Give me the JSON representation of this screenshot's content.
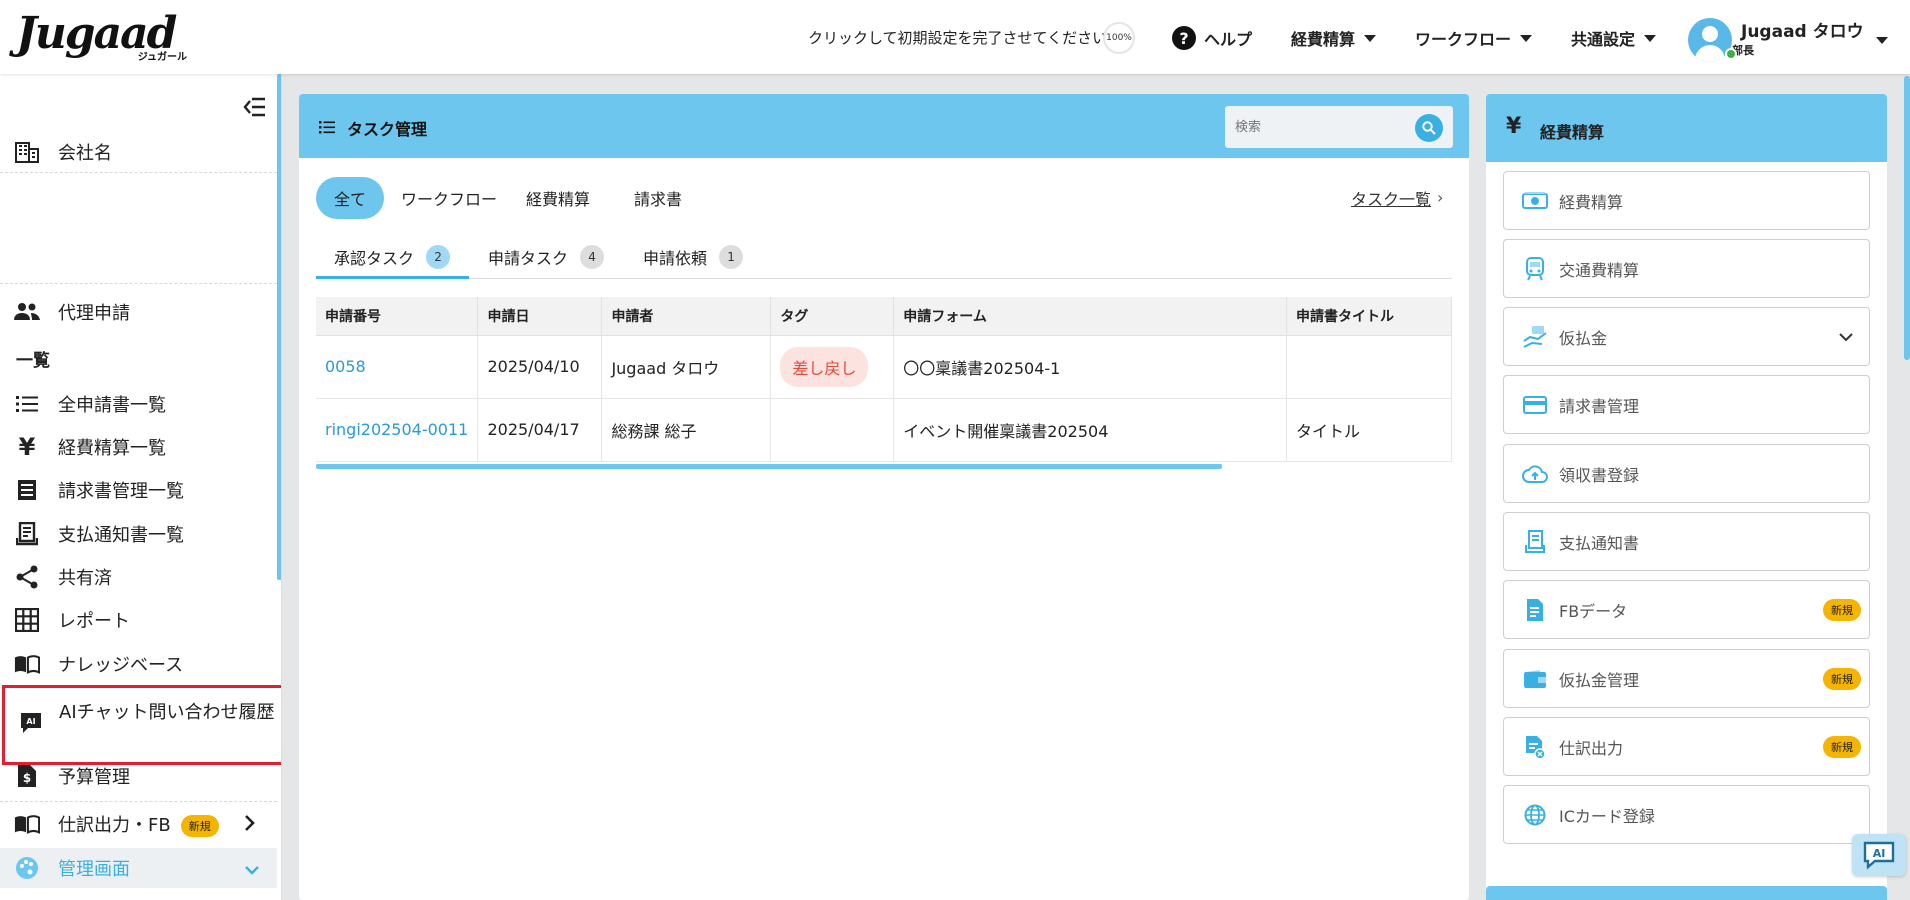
{
  "header": {
    "logo_text": "Jugaad",
    "logo_sub": "ジュガール",
    "setup_message": "クリックして初期設定を完了させてください →",
    "setup_progress": "100%",
    "help": "ヘルプ",
    "nav_expense": "経費精算",
    "nav_workflow": "ワークフロー",
    "nav_common": "共通設定",
    "user_name": "Jugaad タロウ",
    "user_role": "部長"
  },
  "sidebar": {
    "company": "会社名",
    "proxy": "代理申請",
    "list_heading": "一覧",
    "items": [
      {
        "label": "全申請書一覧",
        "icon": "list-icon"
      },
      {
        "label": "経費精算一覧",
        "icon": "yen-icon"
      },
      {
        "label": "請求書管理一覧",
        "icon": "invoice-icon"
      },
      {
        "label": "支払通知書一覧",
        "icon": "receipt-icon"
      },
      {
        "label": "共有済",
        "icon": "share-icon"
      },
      {
        "label": "レポート",
        "icon": "grid-icon"
      },
      {
        "label": "ナレッジベース",
        "icon": "book-icon"
      }
    ],
    "ai_chat": "AIチャット問い合わせ履歴",
    "budget": "予算管理",
    "journal": "仕訳出力・FB",
    "journal_badge": "新規",
    "admin": "管理画面"
  },
  "main": {
    "title": "タスク管理",
    "search_placeholder": "検索",
    "filter_tabs": [
      "全て",
      "ワークフロー",
      "経費精算",
      "請求書"
    ],
    "task_list_link": "タスク一覧",
    "sub_tabs": [
      {
        "label": "承認タスク",
        "count": "2"
      },
      {
        "label": "申請タスク",
        "count": "4"
      },
      {
        "label": "申請依頼",
        "count": "1"
      }
    ],
    "table": {
      "headers": [
        "申請番号",
        "申請日",
        "申請者",
        "タグ",
        "申請フォーム",
        "申請書タイトル"
      ],
      "rows": [
        {
          "id": "0058",
          "date": "2025/04/10",
          "applicant": "Jugaad タロウ",
          "tag": "差し戻し",
          "form": "〇〇稟議書202504-1",
          "title": ""
        },
        {
          "id": "ringi202504-0011",
          "date": "2025/04/17",
          "applicant": "総務課 総子",
          "tag": "",
          "form": "イベント開催稟議書202504",
          "title": "タイトル"
        }
      ]
    }
  },
  "right_panel": {
    "title": "経費精算",
    "new_badge": "新規",
    "buttons": [
      {
        "label": "経費精算",
        "icon": "money-icon"
      },
      {
        "label": "交通費精算",
        "icon": "train-icon"
      },
      {
        "label": "仮払金",
        "icon": "hand-money-icon"
      },
      {
        "label": "請求書管理",
        "icon": "card-icon"
      },
      {
        "label": "領収書登録",
        "icon": "cloud-upload-icon"
      },
      {
        "label": "支払通知書",
        "icon": "receipt-icon"
      },
      {
        "label": "FBデータ",
        "icon": "document-icon"
      },
      {
        "label": "仮払金管理",
        "icon": "wallet-icon"
      },
      {
        "label": "仕訳出力",
        "icon": "journal-icon"
      },
      {
        "label": "ICカード登録",
        "icon": "globe-icon"
      }
    ]
  },
  "colors": {
    "accent": "#6cc6ee",
    "accent_dark": "#3ab0e2",
    "badge": "#f5b400",
    "tag_bg": "#fde3e0",
    "tag_text": "#e24a3a",
    "highlight_border": "#e0202f"
  }
}
